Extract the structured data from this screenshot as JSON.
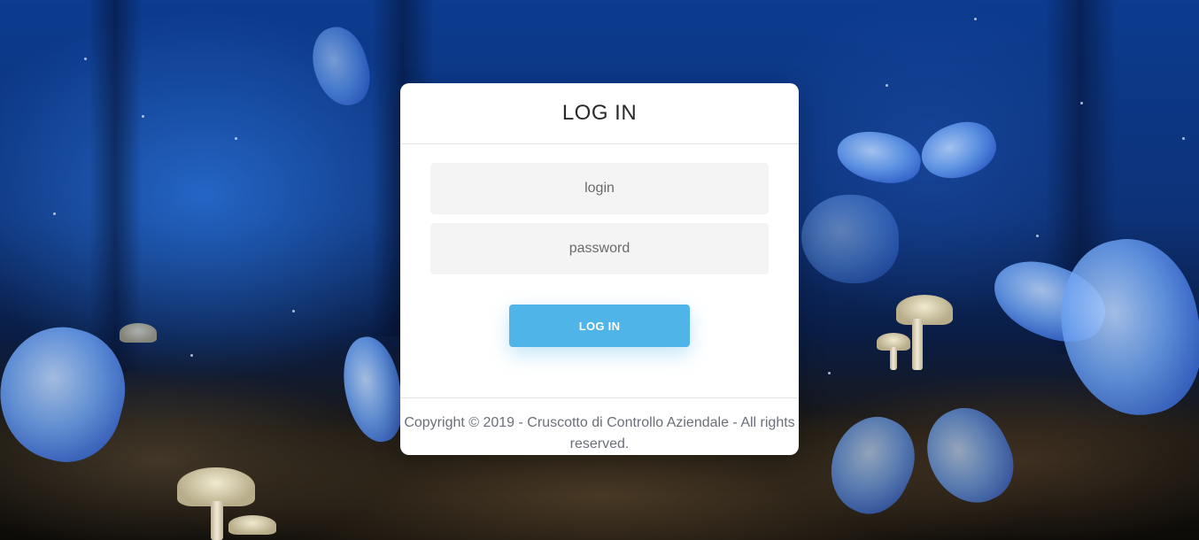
{
  "login_card": {
    "title": "LOG IN",
    "login_placeholder": "login",
    "password_placeholder": "password",
    "login_button_label": "LOG IN",
    "footer_text": "Copyright © 2019 - Cruscotto di Controllo Aziendale - All rights reserved."
  },
  "colors": {
    "accent": "#4fb4e8",
    "card_background": "#ffffff",
    "field_background": "#f4f4f4"
  }
}
